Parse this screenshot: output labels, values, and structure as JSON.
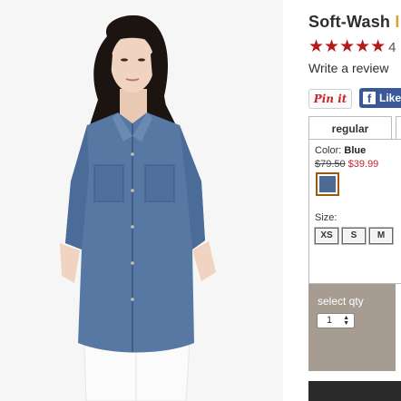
{
  "product": {
    "title_main": "Soft-Wash",
    "title_accent": "I",
    "stars": "★★★★★",
    "rating_count": "4",
    "review_link": "Write a review"
  },
  "social": {
    "pinit_label": "Pin it",
    "facebook_label": "Like",
    "facebook_icon": "f"
  },
  "tabs": {
    "active": "regular"
  },
  "selector": {
    "color_label": "Color:",
    "color_value": "Blue",
    "price_old": "$79.50",
    "price_new": "$39.99",
    "swatch_color": "#4d6a93",
    "size_label": "Size:",
    "sizes": [
      "XS",
      "S",
      "M"
    ]
  },
  "quantity": {
    "label": "select qty",
    "value": "1"
  },
  "colors": {
    "title": "#2e2e2e",
    "stars": "#b21b1b",
    "sale_price": "#c2272d",
    "qty_panel": "#a69c91",
    "facebook": "#3b5998"
  }
}
